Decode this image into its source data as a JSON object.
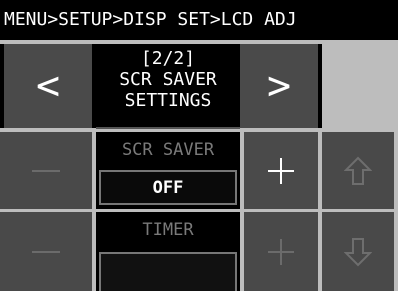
{
  "breadcrumb": "MENU>SETUP>DISP SET>LCD ADJ",
  "page": {
    "indicator": "[2/2]",
    "title_line1": "SCR SAVER",
    "title_line2": "SETTINGS"
  },
  "nav": {
    "prev_label": "<",
    "next_label": ">"
  },
  "scr_saver": {
    "label": "SCR SAVER",
    "value": "OFF"
  },
  "timer": {
    "label": "TIMER",
    "value": ""
  },
  "icons": {
    "minus": "minus-icon",
    "plus": "plus-icon",
    "up": "arrow-up-icon",
    "down": "arrow-down-icon"
  },
  "colors": {
    "background": "#000000",
    "button_active": "#4a4a4a",
    "button_disabled": "#494949",
    "value_border": "#777777",
    "divider": "#bdbdbd"
  }
}
